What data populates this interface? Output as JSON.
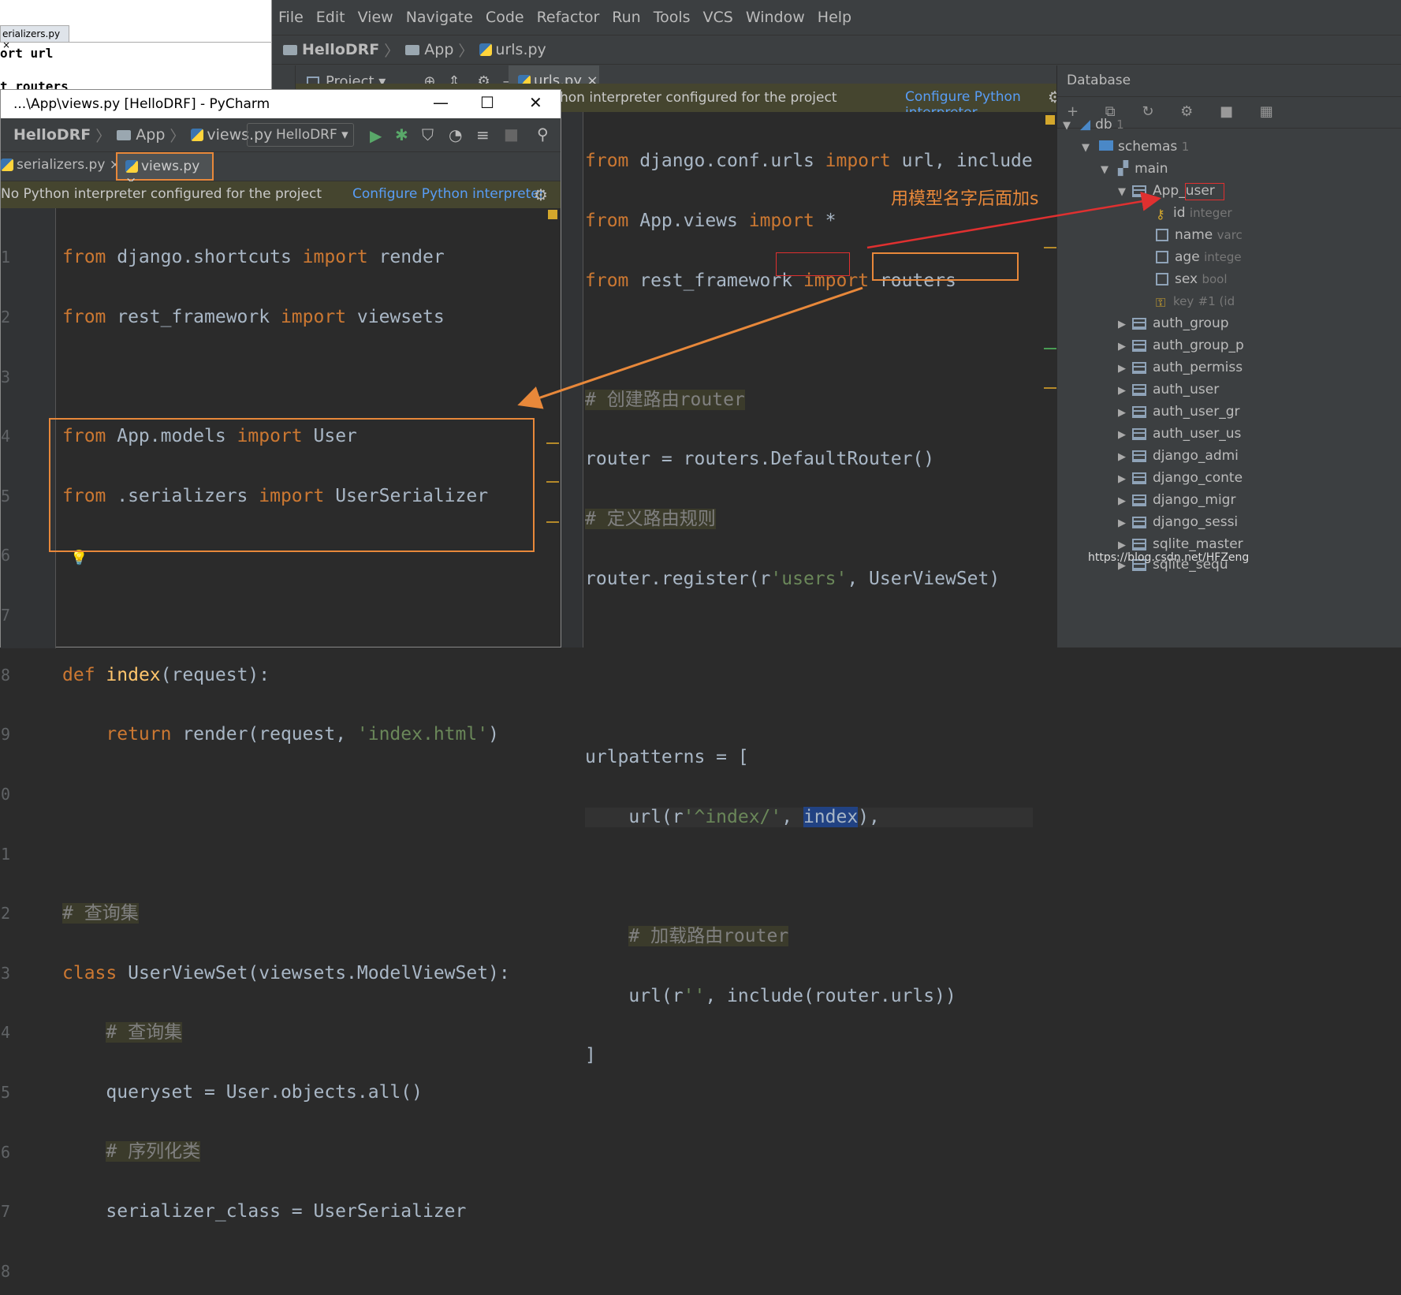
{
  "bg_window": {
    "tab_label": "erializers.py ×",
    "line1": "ort url",
    "line2": "t routers"
  },
  "main": {
    "menu": [
      "File",
      "Edit",
      "View",
      "Navigate",
      "Code",
      "Refactor",
      "Run",
      "Tools",
      "VCS",
      "Window",
      "Help"
    ],
    "breadcrumb": {
      "project": "HelloDRF",
      "folder": "App",
      "file": "urls.py"
    },
    "side_label": "oject",
    "project_tab": "Project ▾",
    "editor_tab": "urls.py ×",
    "notice": "hon interpreter configured for the project",
    "notice_link": "Configure Python interpreter",
    "code_lines": [
      "from django.conf.urls import url, include",
      "from App.views import *",
      "from rest_framework import routers",
      "",
      "# 创建路由router",
      "router = routers.DefaultRouter()",
      "# 定义路由规则",
      "router.register(r'users', UserViewSet)",
      "",
      "",
      "urlpatterns = [",
      "    url(r'^index/', index),",
      "",
      "    # 加载路由router",
      "    url(r'', include(router.urls))",
      "]"
    ]
  },
  "annotation": "用模型名字后面加s",
  "database": {
    "title": "Database",
    "toolbar": "+ ⧉ ↻ ⚙ ■ ▦",
    "db": "db",
    "db_count": "1",
    "schemas": "schemas",
    "schemas_count": "1",
    "main": "main",
    "table_open": "App_user",
    "columns": [
      {
        "name": "id",
        "type": "integer"
      },
      {
        "name": "name",
        "type": "varc"
      },
      {
        "name": "age",
        "type": "intege"
      },
      {
        "name": "sex",
        "type": "bool"
      },
      {
        "name": "key",
        "type": "#1 (id"
      }
    ],
    "tables": [
      "auth_group",
      "auth_group_p",
      "auth_permiss",
      "auth_user",
      "auth_user_gr",
      "auth_user_us",
      "django_admi",
      "django_conte",
      "django_migr",
      "django_sessi",
      "sqlite_master",
      "sqlite_sequ"
    ]
  },
  "front": {
    "title": "...\\App\\views.py [HelloDRF] - PyCharm",
    "breadcrumb": {
      "project": "HelloDRF",
      "folder": "App",
      "file": "views.py"
    },
    "run_config": "HelloDRF",
    "tabs": [
      "serializers.py ×",
      "views.py ×"
    ],
    "notice": "No Python interpreter configured for the project",
    "notice_link": "Configure Python interpreter",
    "line_numbers": [
      "1",
      "2",
      "3",
      "4",
      "5",
      "6",
      "7",
      "8",
      "9",
      "0",
      "1",
      "2",
      "3",
      "4",
      "5",
      "6",
      "7",
      "8"
    ],
    "code_lines": [
      "from django.shortcuts import render",
      "from rest_framework import viewsets",
      "",
      "from App.models import User",
      "from .serializers import UserSerializer",
      "",
      "",
      "def index(request):",
      "    return render(request, 'index.html')",
      "",
      "",
      "# 查询集",
      "class UserViewSet(viewsets.ModelViewSet):",
      "    # 查询集",
      "    queryset = User.objects.all()",
      "    # 序列化类",
      "    serializer_class = UserSerializer",
      ""
    ]
  },
  "watermark": "https://blog.csdn.net/HFZeng"
}
